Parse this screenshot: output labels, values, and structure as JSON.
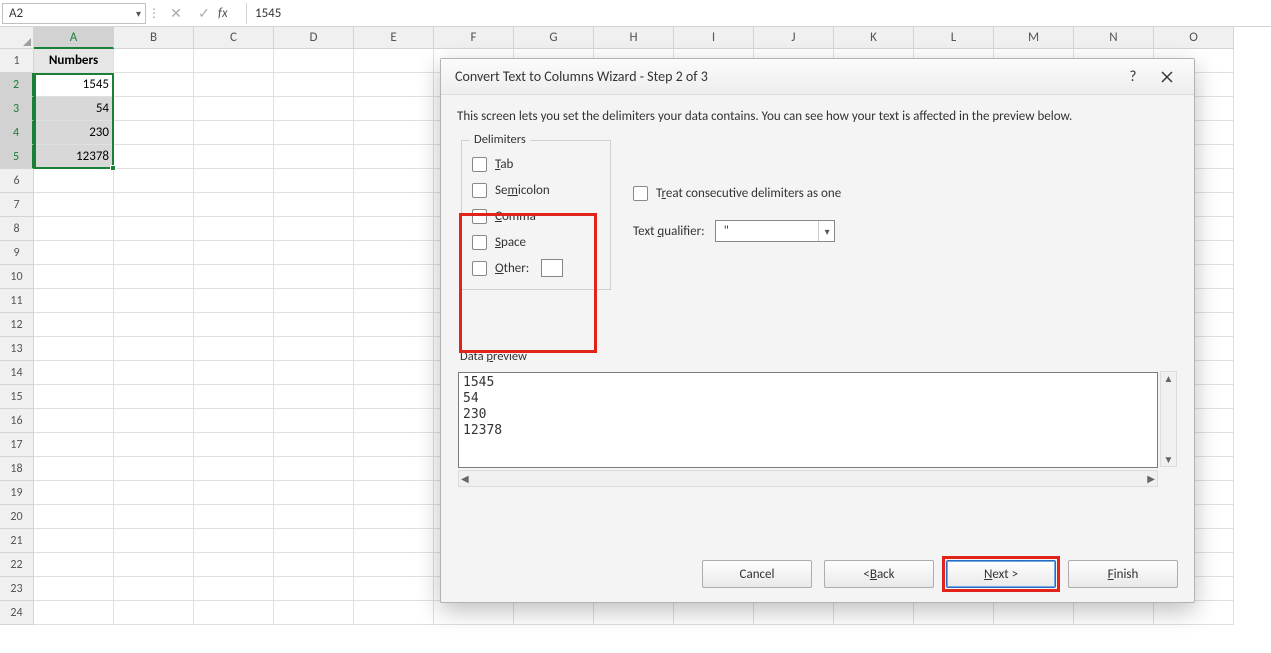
{
  "formula_bar": {
    "namebox": "A2",
    "value": "1545"
  },
  "columns": [
    "A",
    "B",
    "C",
    "D",
    "E",
    "F",
    "G",
    "H",
    "I",
    "J",
    "K",
    "L",
    "M",
    "N",
    "O"
  ],
  "sheet": {
    "header": "Numbers",
    "data": [
      "1545",
      "54",
      "230",
      "12378"
    ]
  },
  "dialog": {
    "title": "Convert Text to Columns Wizard - Step 2 of 3",
    "help": "?",
    "instruction": "This screen lets you set the delimiters your data contains.  You can see how your text is affected in the preview below.",
    "group_delimiters": "Delimiters",
    "chk_tab": "Tab",
    "chk_semicolon": "Semicolon",
    "chk_comma": "Comma",
    "chk_space": "Space",
    "chk_other": "Other:",
    "treat_consecutive": "Treat consecutive delimiters as one",
    "text_qualifier_label": "Text qualifier:",
    "text_qualifier_value": "\"",
    "preview_label": "Data preview",
    "preview_text": "1545\n54\n230\n12378",
    "btn_cancel": "Cancel",
    "btn_back": "< Back",
    "btn_next": "Next >",
    "btn_finish": "Finish"
  }
}
